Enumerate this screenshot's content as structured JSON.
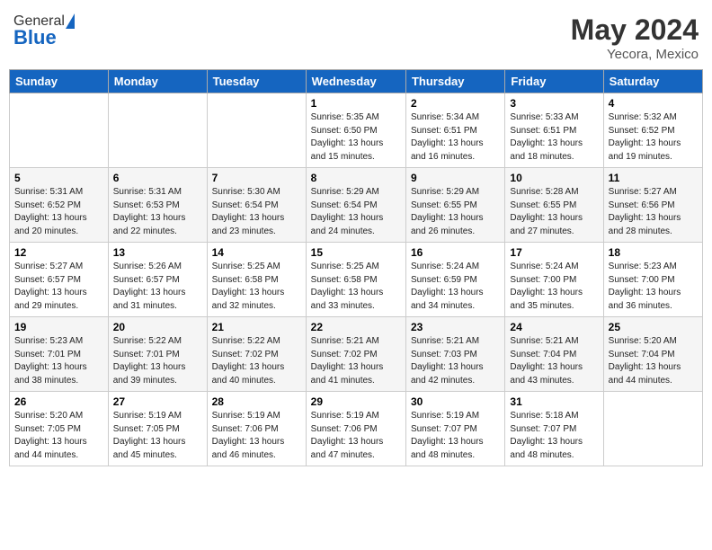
{
  "header": {
    "logo_general": "General",
    "logo_blue": "Blue",
    "month_year": "May 2024",
    "location": "Yecora, Mexico"
  },
  "days_of_week": [
    "Sunday",
    "Monday",
    "Tuesday",
    "Wednesday",
    "Thursday",
    "Friday",
    "Saturday"
  ],
  "weeks": [
    [
      {
        "day": "",
        "info": ""
      },
      {
        "day": "",
        "info": ""
      },
      {
        "day": "",
        "info": ""
      },
      {
        "day": "1",
        "info": "Sunrise: 5:35 AM\nSunset: 6:50 PM\nDaylight: 13 hours\nand 15 minutes."
      },
      {
        "day": "2",
        "info": "Sunrise: 5:34 AM\nSunset: 6:51 PM\nDaylight: 13 hours\nand 16 minutes."
      },
      {
        "day": "3",
        "info": "Sunrise: 5:33 AM\nSunset: 6:51 PM\nDaylight: 13 hours\nand 18 minutes."
      },
      {
        "day": "4",
        "info": "Sunrise: 5:32 AM\nSunset: 6:52 PM\nDaylight: 13 hours\nand 19 minutes."
      }
    ],
    [
      {
        "day": "5",
        "info": "Sunrise: 5:31 AM\nSunset: 6:52 PM\nDaylight: 13 hours\nand 20 minutes."
      },
      {
        "day": "6",
        "info": "Sunrise: 5:31 AM\nSunset: 6:53 PM\nDaylight: 13 hours\nand 22 minutes."
      },
      {
        "day": "7",
        "info": "Sunrise: 5:30 AM\nSunset: 6:54 PM\nDaylight: 13 hours\nand 23 minutes."
      },
      {
        "day": "8",
        "info": "Sunrise: 5:29 AM\nSunset: 6:54 PM\nDaylight: 13 hours\nand 24 minutes."
      },
      {
        "day": "9",
        "info": "Sunrise: 5:29 AM\nSunset: 6:55 PM\nDaylight: 13 hours\nand 26 minutes."
      },
      {
        "day": "10",
        "info": "Sunrise: 5:28 AM\nSunset: 6:55 PM\nDaylight: 13 hours\nand 27 minutes."
      },
      {
        "day": "11",
        "info": "Sunrise: 5:27 AM\nSunset: 6:56 PM\nDaylight: 13 hours\nand 28 minutes."
      }
    ],
    [
      {
        "day": "12",
        "info": "Sunrise: 5:27 AM\nSunset: 6:57 PM\nDaylight: 13 hours\nand 29 minutes."
      },
      {
        "day": "13",
        "info": "Sunrise: 5:26 AM\nSunset: 6:57 PM\nDaylight: 13 hours\nand 31 minutes."
      },
      {
        "day": "14",
        "info": "Sunrise: 5:25 AM\nSunset: 6:58 PM\nDaylight: 13 hours\nand 32 minutes."
      },
      {
        "day": "15",
        "info": "Sunrise: 5:25 AM\nSunset: 6:58 PM\nDaylight: 13 hours\nand 33 minutes."
      },
      {
        "day": "16",
        "info": "Sunrise: 5:24 AM\nSunset: 6:59 PM\nDaylight: 13 hours\nand 34 minutes."
      },
      {
        "day": "17",
        "info": "Sunrise: 5:24 AM\nSunset: 7:00 PM\nDaylight: 13 hours\nand 35 minutes."
      },
      {
        "day": "18",
        "info": "Sunrise: 5:23 AM\nSunset: 7:00 PM\nDaylight: 13 hours\nand 36 minutes."
      }
    ],
    [
      {
        "day": "19",
        "info": "Sunrise: 5:23 AM\nSunset: 7:01 PM\nDaylight: 13 hours\nand 38 minutes."
      },
      {
        "day": "20",
        "info": "Sunrise: 5:22 AM\nSunset: 7:01 PM\nDaylight: 13 hours\nand 39 minutes."
      },
      {
        "day": "21",
        "info": "Sunrise: 5:22 AM\nSunset: 7:02 PM\nDaylight: 13 hours\nand 40 minutes."
      },
      {
        "day": "22",
        "info": "Sunrise: 5:21 AM\nSunset: 7:02 PM\nDaylight: 13 hours\nand 41 minutes."
      },
      {
        "day": "23",
        "info": "Sunrise: 5:21 AM\nSunset: 7:03 PM\nDaylight: 13 hours\nand 42 minutes."
      },
      {
        "day": "24",
        "info": "Sunrise: 5:21 AM\nSunset: 7:04 PM\nDaylight: 13 hours\nand 43 minutes."
      },
      {
        "day": "25",
        "info": "Sunrise: 5:20 AM\nSunset: 7:04 PM\nDaylight: 13 hours\nand 44 minutes."
      }
    ],
    [
      {
        "day": "26",
        "info": "Sunrise: 5:20 AM\nSunset: 7:05 PM\nDaylight: 13 hours\nand 44 minutes."
      },
      {
        "day": "27",
        "info": "Sunrise: 5:19 AM\nSunset: 7:05 PM\nDaylight: 13 hours\nand 45 minutes."
      },
      {
        "day": "28",
        "info": "Sunrise: 5:19 AM\nSunset: 7:06 PM\nDaylight: 13 hours\nand 46 minutes."
      },
      {
        "day": "29",
        "info": "Sunrise: 5:19 AM\nSunset: 7:06 PM\nDaylight: 13 hours\nand 47 minutes."
      },
      {
        "day": "30",
        "info": "Sunrise: 5:19 AM\nSunset: 7:07 PM\nDaylight: 13 hours\nand 48 minutes."
      },
      {
        "day": "31",
        "info": "Sunrise: 5:18 AM\nSunset: 7:07 PM\nDaylight: 13 hours\nand 48 minutes."
      },
      {
        "day": "",
        "info": ""
      }
    ]
  ]
}
